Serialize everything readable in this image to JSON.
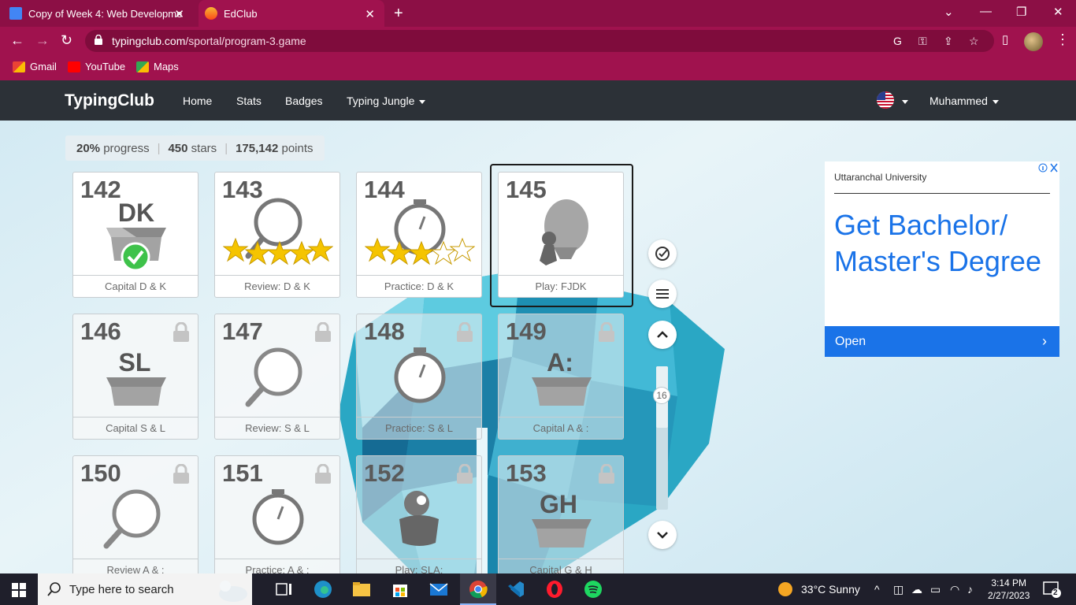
{
  "browser": {
    "tabs": [
      {
        "title": "Copy of Week 4: Web Developme",
        "icon": "google-docs-icon"
      },
      {
        "title": "EdClub",
        "icon": "edclub-flame-icon",
        "active": true
      }
    ],
    "url_domain": "typingclub.com",
    "url_path": "/sportal/program-3.game",
    "bookmarks": [
      {
        "label": "Gmail",
        "icon": "gmail-icon"
      },
      {
        "label": "YouTube",
        "icon": "youtube-icon"
      },
      {
        "label": "Maps",
        "icon": "maps-icon"
      }
    ]
  },
  "site": {
    "brand": "TypingClub",
    "nav": [
      "Home",
      "Stats",
      "Badges",
      "Typing Jungle"
    ],
    "user": "Muhammed"
  },
  "progress": {
    "percent": "20%",
    "percent_label": "progress",
    "stars": "450",
    "stars_label": "stars",
    "points": "175,142",
    "points_label": "points"
  },
  "lessons": [
    {
      "num": "142",
      "label": "Capital D & K",
      "art": "box",
      "box_text": "DK",
      "stars": 0,
      "completed": true,
      "locked": false
    },
    {
      "num": "143",
      "label": "Review: D & K",
      "art": "magnifier",
      "stars": 5,
      "locked": false
    },
    {
      "num": "144",
      "label": "Practice: D & K",
      "art": "stopwatch",
      "stars": 3,
      "locked": false
    },
    {
      "num": "145",
      "label": "Play: FJDK",
      "art": "balloon",
      "stars": 0,
      "locked": false,
      "selected": true
    },
    {
      "num": "146",
      "label": "Capital S & L",
      "art": "box",
      "box_text": "SL",
      "locked": true
    },
    {
      "num": "147",
      "label": "Review: S & L",
      "art": "magnifier",
      "locked": true
    },
    {
      "num": "148",
      "label": "Practice: S & L",
      "art": "stopwatch",
      "locked": true
    },
    {
      "num": "149",
      "label": "Capital A & :",
      "art": "box",
      "box_text": "A:",
      "locked": true
    },
    {
      "num": "150",
      "label": "Review A & :",
      "art": "magnifier",
      "locked": true
    },
    {
      "num": "151",
      "label": "Practice: A & :",
      "art": "stopwatch",
      "locked": true
    },
    {
      "num": "152",
      "label": "Play: SLA:",
      "art": "pot",
      "locked": true
    },
    {
      "num": "153",
      "label": "Capital G & H",
      "art": "box",
      "box_text": "GH",
      "locked": true
    }
  ],
  "scroll_badge": "16",
  "ad": {
    "sponsor": "Uttaranchal University",
    "headline": "Get Bachelor/ Master's Degree",
    "cta": "Open"
  },
  "taskbar": {
    "search_placeholder": "Type here to search",
    "weather": "33°C  Sunny",
    "time": "3:14 PM",
    "date": "2/27/2023",
    "notifications": "2"
  },
  "colors": {
    "chrome": "#a0124e",
    "tabbar": "#8c0f45",
    "nav": "#2c3137",
    "star": "#f5c400",
    "check": "#3ec24a",
    "ad_blue": "#1a73e8"
  }
}
